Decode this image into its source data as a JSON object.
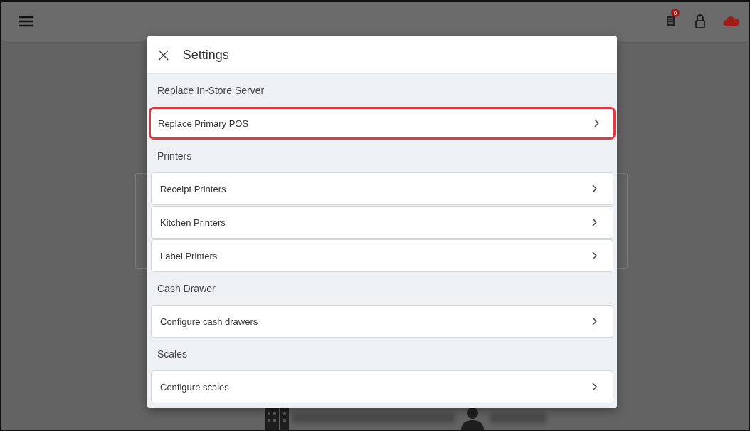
{
  "top_bar": {
    "badge": "0"
  },
  "dialog": {
    "title": "Settings",
    "close": "×",
    "sections": [
      {
        "heading": "Replace In-Store Server",
        "items": [
          {
            "label": "Replace Primary POS",
            "highlighted": true
          }
        ]
      },
      {
        "heading": "Printers",
        "items": [
          {
            "label": "Receipt Printers",
            "highlighted": false
          },
          {
            "label": "Kitchen Printers",
            "highlighted": false
          },
          {
            "label": "Label Printers",
            "highlighted": false
          }
        ]
      },
      {
        "heading": "Cash Drawer",
        "items": [
          {
            "label": "Configure cash drawers",
            "highlighted": false
          }
        ]
      },
      {
        "heading": "Scales",
        "items": [
          {
            "label": "Configure scales",
            "highlighted": false
          }
        ]
      }
    ]
  }
}
